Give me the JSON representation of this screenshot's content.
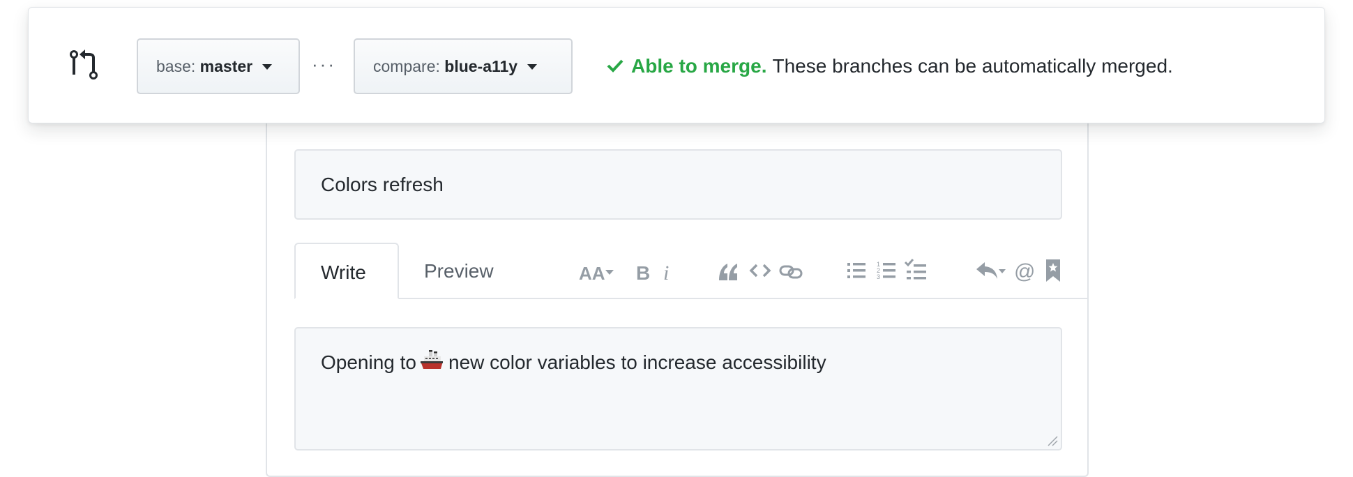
{
  "compare": {
    "base_prefix": "base:",
    "base_branch": "master",
    "separator": "···",
    "compare_prefix": "compare:",
    "compare_branch": "blue-a11y",
    "merge_status_title": "Able to merge.",
    "merge_status_text": "These branches can be automatically merged.",
    "status_color": "#28a745"
  },
  "form": {
    "title_value": "Colors refresh",
    "tabs": [
      {
        "label": "Write",
        "active": true
      },
      {
        "label": "Preview",
        "active": false
      }
    ],
    "toolbar_icons": [
      "text-size-icon",
      "bold-icon",
      "italic-icon",
      "quote-icon",
      "code-icon",
      "link-icon",
      "unordered-list-icon",
      "ordered-list-icon",
      "task-list-icon",
      "reply-icon",
      "mention-icon",
      "bookmark-icon"
    ],
    "body_text_before": "Opening to",
    "body_emoji": "ship-icon",
    "body_text_after": "new color variables to increase accessibility"
  }
}
